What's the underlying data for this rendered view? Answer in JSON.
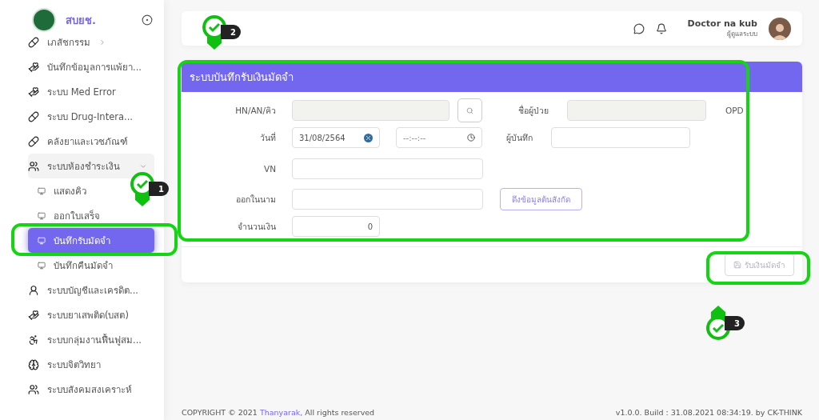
{
  "sidebar": {
    "brand": "สบยช.",
    "items": [
      {
        "label": "เภสัชกรรม",
        "kind": "group",
        "expanded": false,
        "selected": false
      },
      {
        "label": "บันทึกข้อมูลการแพ้ยา...",
        "kind": "item",
        "selected": false
      },
      {
        "label": "ระบบ Med Error",
        "kind": "item",
        "selected": false
      },
      {
        "label": "ระบบ Drug-Intera...",
        "kind": "item",
        "selected": false
      },
      {
        "label": "คลังยาและเวชภัณฑ์",
        "kind": "item",
        "selected": false
      },
      {
        "label": "ระบบห้องชำระเงิน",
        "kind": "group",
        "expanded": true,
        "selected": false,
        "children": [
          {
            "label": "แสดงคิว",
            "selected": false
          },
          {
            "label": "ออกใบเสร็จ",
            "selected": false
          },
          {
            "label": "บันทึกรับมัดจำ",
            "selected": true
          },
          {
            "label": "บันทึกคืนมัดจำ",
            "selected": false
          }
        ]
      },
      {
        "label": "ระบบบัญชีและเครดิต...",
        "kind": "item",
        "selected": false
      },
      {
        "label": "ระบบยาเสพติด(บสต)",
        "kind": "item",
        "selected": false
      },
      {
        "label": "ระบบกลุ่มงานฟื้นฟูสม...",
        "kind": "item",
        "selected": false
      },
      {
        "label": "ระบบจิตวิทยา",
        "kind": "item",
        "selected": false
      },
      {
        "label": "ระบบสังคมสงเคราะห์",
        "kind": "item",
        "selected": false
      }
    ]
  },
  "header": {
    "user_name": "Doctor na kub",
    "user_role": "ผู้ดูแลระบบ"
  },
  "form": {
    "title": "ระบบบันทึกรับเงินมัดจำ",
    "hn": {
      "label": "HN/AN/คิว",
      "disabled": true
    },
    "patient_name": {
      "label": "ชื่อผู้ป่วย",
      "disabled": true
    },
    "visit_type": "OPD",
    "date": {
      "label": "วันที่",
      "value": "31/08/2564"
    },
    "time": {
      "placeholder": "--:--:--"
    },
    "recorder": {
      "label": "ผู้บันทึก"
    },
    "vn": {
      "label": "VN"
    },
    "issued_to": {
      "label": "ออกในนาม"
    },
    "fetch_button": "ดึงข้อมูลต้นสังกัด",
    "amount": {
      "label": "จำนวนเงิน",
      "value": "0"
    },
    "submit": {
      "label": "รับเงินมัดจำ",
      "disabled": true
    }
  },
  "annotations": [
    {
      "label": "1"
    },
    {
      "label": "2"
    },
    {
      "label": "3"
    }
  ],
  "footer": {
    "copyright_prefix": "COPYRIGHT © 2021",
    "copyright_link": "Thanyarak,",
    "copyright_suffix": "All rights reserved",
    "build": "v1.0.0. Build : 31.08.2021 08:34:19. by CK-THINK"
  }
}
